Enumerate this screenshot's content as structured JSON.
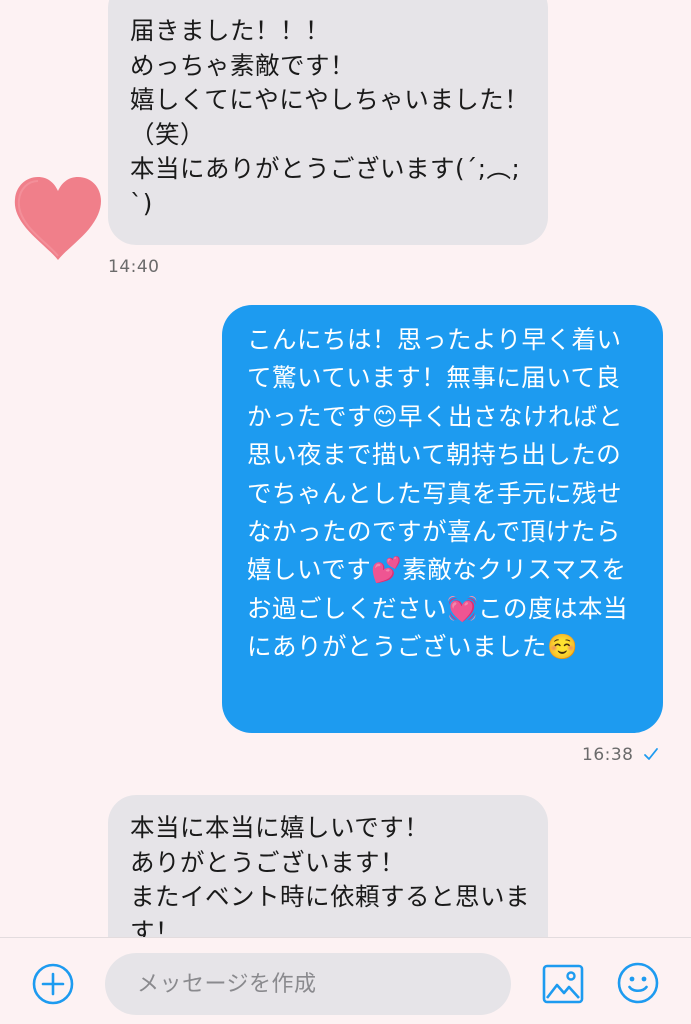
{
  "messages": [
    {
      "direction": "incoming",
      "text": "届きました！！！\nめっちゃ素敵です！\n嬉しくてにやにやしちゃいました！（笑）\n本当にありがとうございます(´;︵;`)",
      "time": "14:40"
    },
    {
      "direction": "outgoing",
      "text": "こんにちは！思ったより早く着いて驚いています！無事に届いて良かったです😊早く出さなければと思い夜まで描いて朝持ち出したのでちゃんとした写真を手元に残せなかったのですが喜んで頂けたら嬉しいです💕素敵なクリスマスをお過ごしください💓この度は本当にありがとうございました☺️",
      "time": "16:38",
      "status": "read-check"
    },
    {
      "direction": "incoming",
      "text": "本当に本当に嬉しいです！\nありがとうございます！\nまたイベント時に依頼すると思います！"
    }
  ],
  "sticker": "heart-sticker",
  "composer": {
    "placeholder": "メッセージを作成",
    "icons": [
      "plus-circle-icon",
      "image-icon",
      "smiley-icon"
    ]
  },
  "colors": {
    "background": "#fdf2f3",
    "incoming_bubble": "#e6e4e8",
    "outgoing_bubble": "#1d9bf0",
    "accent": "#1d9bf0",
    "heart": "#f07f8a"
  }
}
